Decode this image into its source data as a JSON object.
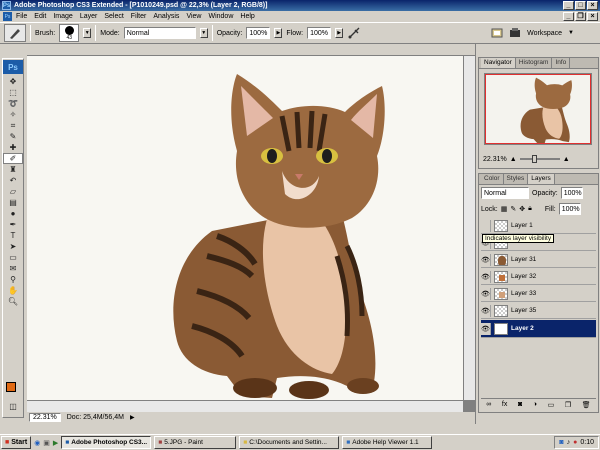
{
  "window": {
    "title": "Adobe Photoshop CS3 Extended - [P1010249.psd @ 22,3% (Layer 2, RGB/8)]",
    "app_icon": "Ps"
  },
  "menu": {
    "items": [
      "File",
      "Edit",
      "Image",
      "Layer",
      "Select",
      "Filter",
      "Analysis",
      "View",
      "Window",
      "Help"
    ]
  },
  "options": {
    "brush_label": "Brush:",
    "brush_size": "43",
    "mode_label": "Mode:",
    "mode_value": "Normal",
    "opacity_label": "Opacity:",
    "opacity_value": "100%",
    "flow_label": "Flow:",
    "flow_value": "100%",
    "workspace_label": "Workspace"
  },
  "toolbox": {
    "logo": "Ps",
    "tools": [
      "move",
      "marquee",
      "lasso",
      "magic-wand",
      "crop",
      "slice",
      "healing",
      "brush",
      "stamp",
      "history-brush",
      "eraser",
      "gradient",
      "dodge",
      "pen",
      "type",
      "path-select",
      "shape",
      "notes",
      "eyedropper",
      "hand",
      "zoom"
    ],
    "active_tool": "brush",
    "foreground_color": "#e06a14",
    "background_color": "#ffffff"
  },
  "status": {
    "zoom": "22.31%",
    "doc": "Doc: 25,4M/56,4M"
  },
  "navigator": {
    "tabs": [
      "Navigator",
      "Histogram",
      "Info"
    ],
    "active_tab": "Navigator",
    "zoom": "22.31%"
  },
  "layers_panel": {
    "tabs": [
      "Color",
      "Styles",
      "Layers"
    ],
    "active_tab": "Layers",
    "blend_mode": "Normal",
    "opacity_label": "Opacity:",
    "opacity_value": "100%",
    "lock_label": "Lock:",
    "fill_label": "Fill:",
    "fill_value": "100%",
    "tooltip": "Indicates layer visibility",
    "layers": [
      {
        "name": "Layer 1",
        "visible": false,
        "selected": false
      },
      {
        "name": "",
        "visible": true,
        "selected": false
      },
      {
        "name": "Layer 31",
        "visible": true,
        "selected": false
      },
      {
        "name": "Layer 32",
        "visible": true,
        "selected": false
      },
      {
        "name": "Layer 33",
        "visible": true,
        "selected": false
      },
      {
        "name": "Layer 35",
        "visible": true,
        "selected": false
      },
      {
        "name": "Layer 2",
        "visible": true,
        "selected": true
      }
    ]
  },
  "taskbar": {
    "start": "Start",
    "items": [
      "Adobe Photoshop CS3...",
      "5.JPG - Paint",
      "C:\\Documents and Settin...",
      "Adobe Help Viewer 1.1"
    ],
    "active_item": "Adobe Photoshop CS3...",
    "clock": "0:10"
  }
}
